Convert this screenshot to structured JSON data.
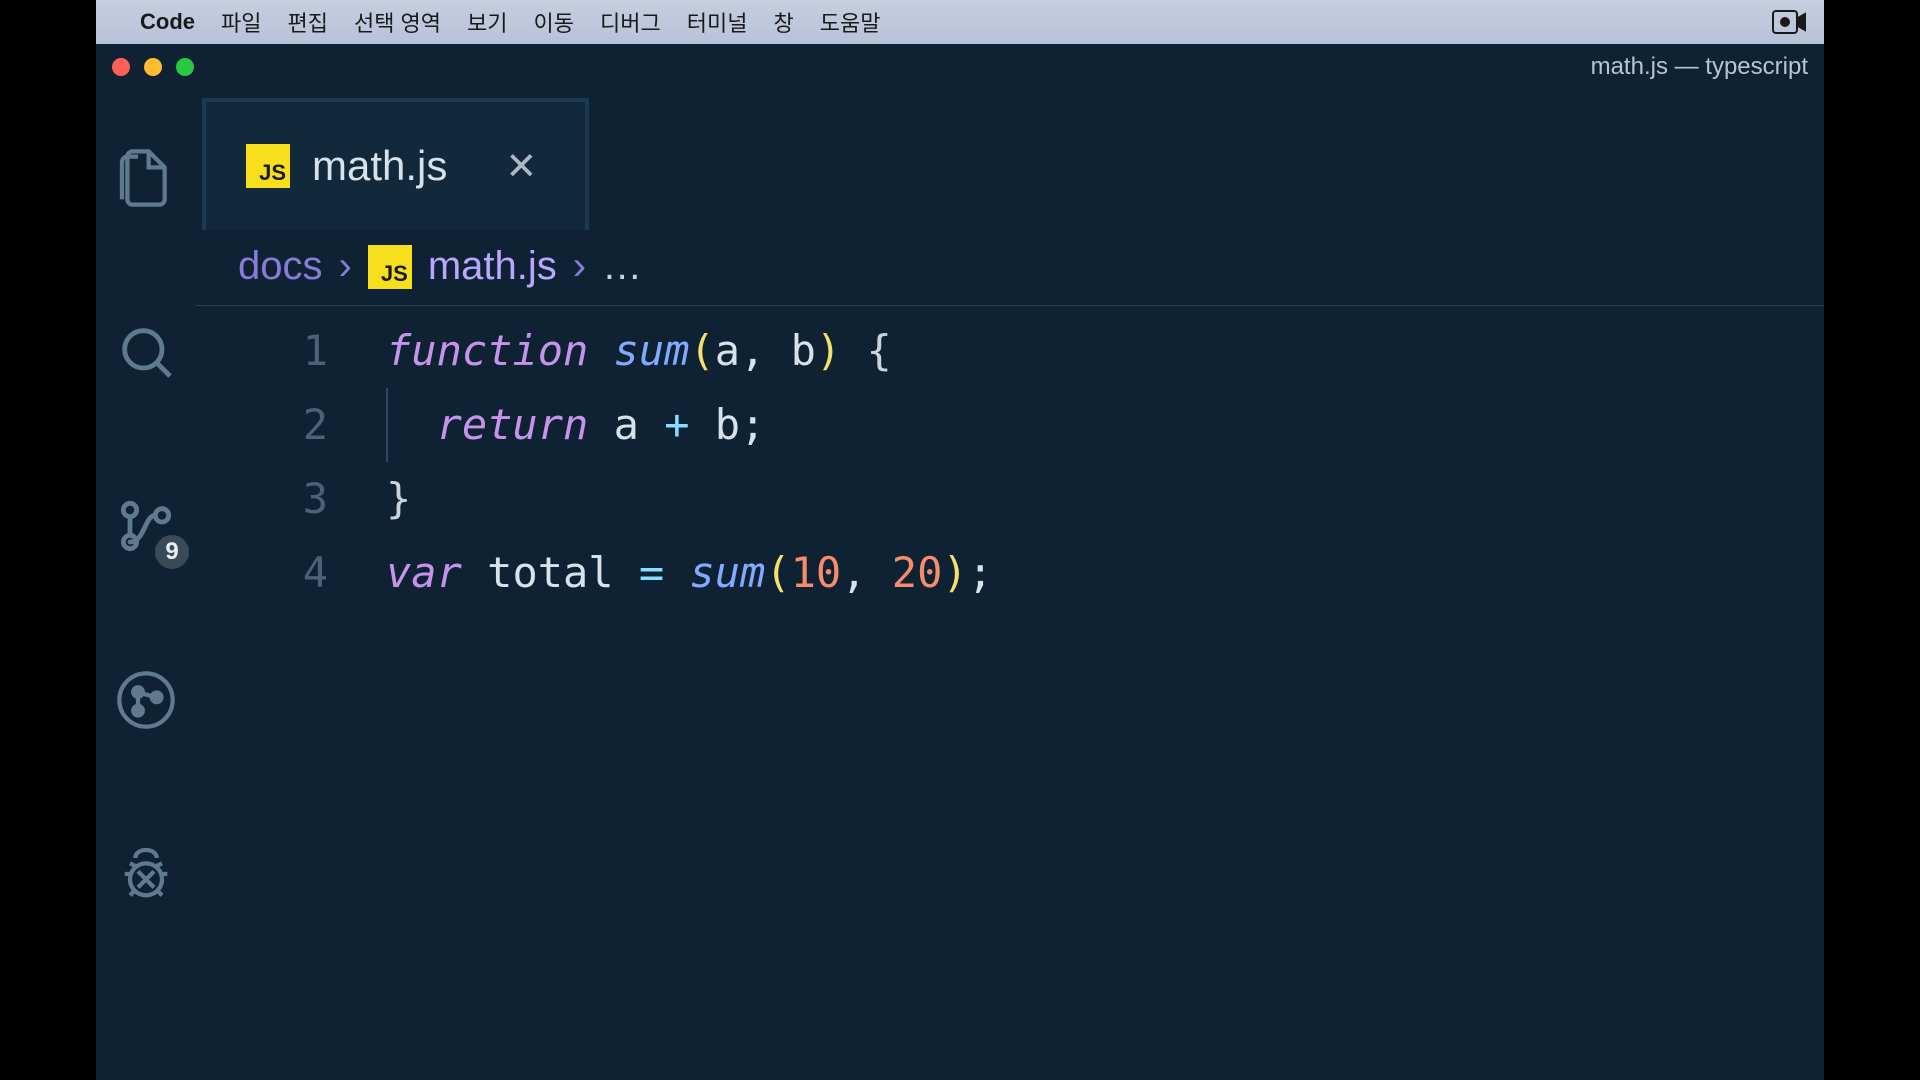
{
  "menubar": {
    "app": "Code",
    "items": [
      "파일",
      "편집",
      "선택 영역",
      "보기",
      "이동",
      "디버그",
      "터미널",
      "창",
      "도움말"
    ]
  },
  "window": {
    "title": "math.js — typescript"
  },
  "activitybar": {
    "scm_badge": "9"
  },
  "tab": {
    "icon_label": "JS",
    "filename": "math.js"
  },
  "breadcrumb": {
    "folder": "docs",
    "icon_label": "JS",
    "file": "math.js",
    "rest": "…"
  },
  "code": {
    "line_numbers": [
      "1",
      "2",
      "3",
      "4"
    ],
    "l1": {
      "kw": "function",
      "sp1": " ",
      "fn": "sum",
      "paren_o": "(",
      "a": "a",
      "comma": ", ",
      "b": "b",
      "paren_c": ")",
      "sp2": " ",
      "brace_o": "{"
    },
    "l2": {
      "indent": "  ",
      "kw": "return",
      "sp1": " ",
      "a": "a",
      "sp2": " ",
      "op": "+",
      "sp3": " ",
      "b": "b",
      "semi": ";"
    },
    "l3": {
      "brace_c": "}"
    },
    "l4": {
      "kw": "var",
      "sp1": " ",
      "name": "total",
      "sp2": " ",
      "eq": "=",
      "sp3": " ",
      "fn": "sum",
      "paren_o": "(",
      "n1": "10",
      "comma": ", ",
      "n2": "20",
      "paren_c": ")",
      "semi": ";"
    }
  }
}
